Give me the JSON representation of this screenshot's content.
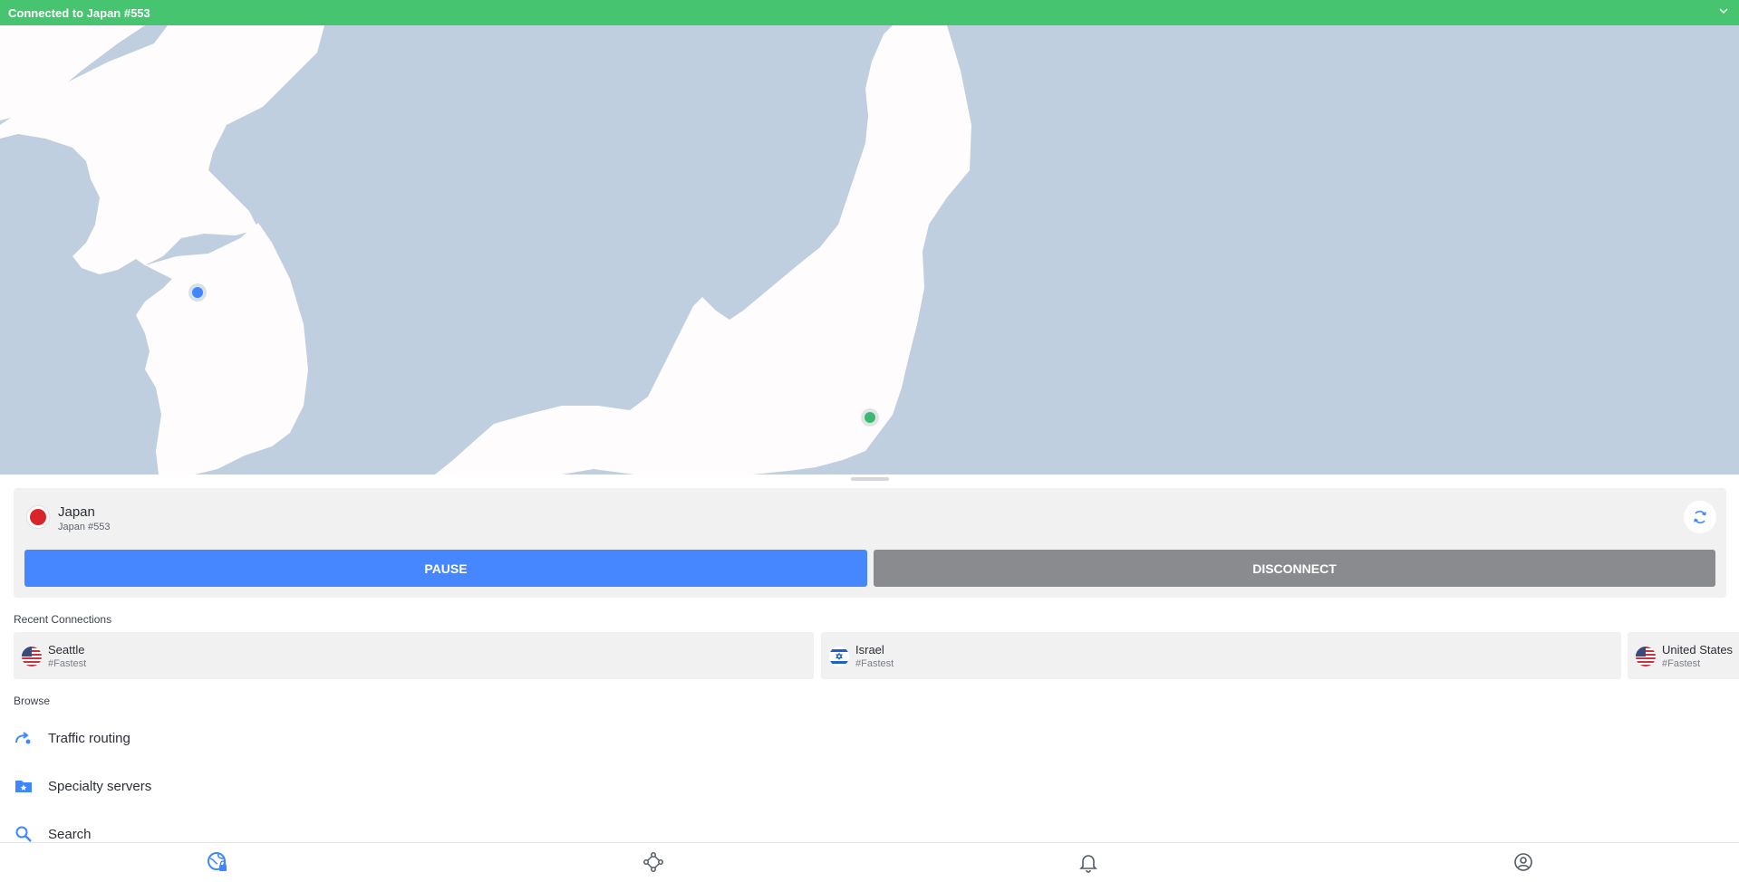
{
  "status": {
    "text": "Connected to Japan #553",
    "color": "#47c46f"
  },
  "connection": {
    "country": "Japan",
    "server": "Japan #553",
    "pause_label": "PAUSE",
    "disconnect_label": "DISCONNECT",
    "pause_color": "#4687ff",
    "disconnect_color": "#8a8b8f"
  },
  "recent": {
    "title": "Recent Connections",
    "items": [
      {
        "name": "Seattle",
        "sub": "#Fastest",
        "flag": "us-flag-icon"
      },
      {
        "name": "Israel",
        "sub": "#Fastest",
        "flag": "israel-flag-icon"
      },
      {
        "name": "United States",
        "sub": "#Fastest",
        "flag": "us-flag-icon"
      }
    ]
  },
  "browse": {
    "title": "Browse",
    "items": [
      {
        "label": "Traffic routing",
        "icon": "traffic-routing-icon"
      },
      {
        "label": "Specialty servers",
        "icon": "specialty-folder-icon"
      },
      {
        "label": "Search",
        "icon": "search-icon"
      }
    ]
  },
  "nav": {
    "items": [
      "globe-lock-icon",
      "meshnet-icon",
      "bell-icon",
      "profile-icon"
    ]
  }
}
